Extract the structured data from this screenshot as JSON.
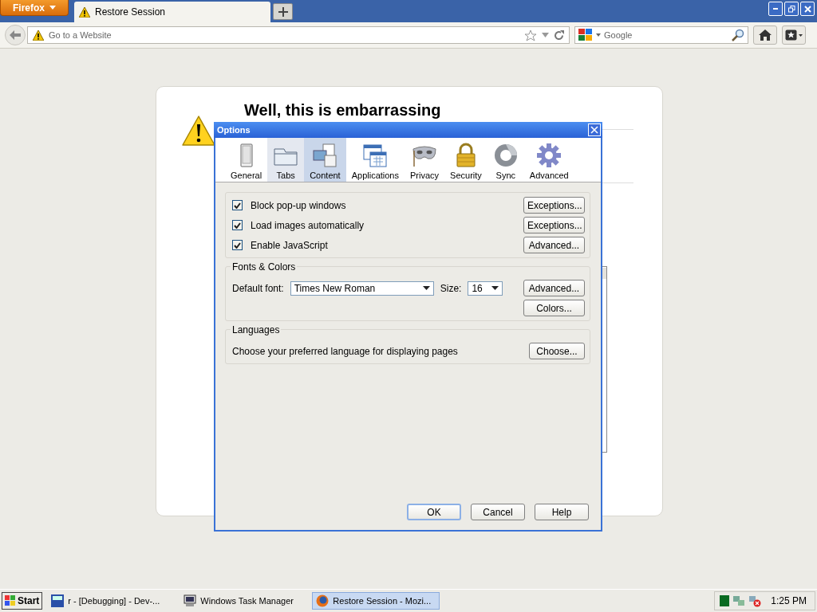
{
  "browser": {
    "menu_button": "Firefox",
    "tab": {
      "title": "Restore Session"
    },
    "address": {
      "placeholder": "Go to a Website"
    },
    "search": {
      "placeholder": "Google"
    }
  },
  "page": {
    "heading": "Well, this is embarrassing"
  },
  "dialog": {
    "title": "Options",
    "tabs": [
      {
        "label": "General",
        "selected": false,
        "hovered": false
      },
      {
        "label": "Tabs",
        "selected": false,
        "hovered": true
      },
      {
        "label": "Content",
        "selected": true,
        "hovered": false
      },
      {
        "label": "Applications",
        "selected": false,
        "hovered": false
      },
      {
        "label": "Privacy",
        "selected": false,
        "hovered": false
      },
      {
        "label": "Security",
        "selected": false,
        "hovered": false
      },
      {
        "label": "Sync",
        "selected": false,
        "hovered": false
      },
      {
        "label": "Advanced",
        "selected": false,
        "hovered": false
      }
    ],
    "options": [
      {
        "label": "Block pop-up windows",
        "checked": true,
        "button": "Exceptions..."
      },
      {
        "label": "Load images automatically",
        "checked": true,
        "button": "Exceptions..."
      },
      {
        "label": "Enable JavaScript",
        "checked": true,
        "button": "Advanced..."
      }
    ],
    "fonts": {
      "title": "Fonts & Colors",
      "font_label": "Default font:",
      "font": "Times New Roman",
      "size_label": "Size:",
      "size": "16",
      "buttons": [
        "Advanced...",
        "Colors..."
      ]
    },
    "languages": {
      "title": "Languages",
      "text": "Choose your preferred language for displaying pages",
      "button": "Choose..."
    },
    "buttons": [
      {
        "label": "OK",
        "default": true
      },
      {
        "label": "Cancel",
        "default": false
      },
      {
        "label": "Help",
        "default": false
      }
    ]
  },
  "taskbar": {
    "start": "Start",
    "tasks": [
      {
        "label": "r - [Debugging] - Dev-...",
        "selected": false
      },
      {
        "label": "Windows Task Manager",
        "selected": false
      },
      {
        "label": "Restore Session - Mozi...",
        "selected": true
      }
    ],
    "time": "1:25 PM"
  }
}
